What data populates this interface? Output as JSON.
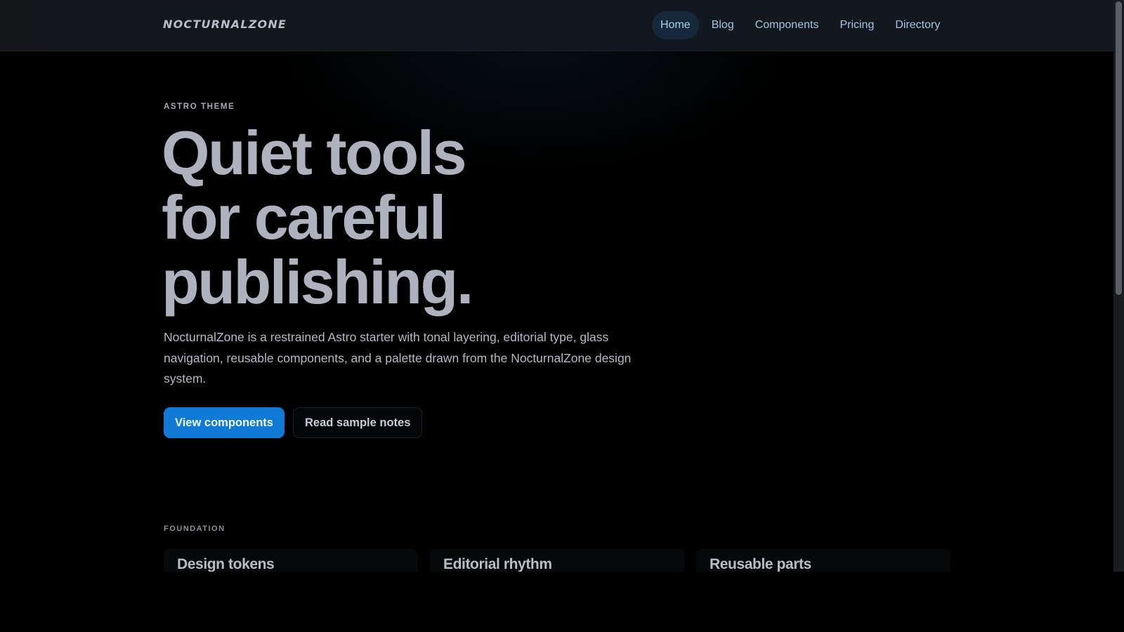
{
  "header": {
    "brand": "NOCTURNALZONE",
    "nav": [
      {
        "label": "Home",
        "active": true
      },
      {
        "label": "Blog",
        "active": false
      },
      {
        "label": "Components",
        "active": false
      },
      {
        "label": "Pricing",
        "active": false
      },
      {
        "label": "Directory",
        "active": false
      }
    ]
  },
  "hero": {
    "eyebrow": "ASTRO THEME",
    "title_lines": [
      "Quiet tools",
      "for careful",
      "publishing."
    ],
    "description": "NocturnalZone is a restrained Astro starter with tonal layering, editorial type, glass navigation, reusable components, and a palette drawn from the NocturnalZone design system.",
    "primary_cta": "View components",
    "secondary_cta": "Read sample notes"
  },
  "foundation": {
    "label": "FOUNDATION",
    "cards": [
      {
        "title": "Design tokens"
      },
      {
        "title": "Editorial rhythm"
      },
      {
        "title": "Reusable parts"
      }
    ]
  },
  "colors": {
    "background": "#000000",
    "accent": "#0f7bd6",
    "nav_text": "#9fc6e4",
    "nav_active_bg": "#16293a",
    "heading": "#aeb2bf"
  }
}
